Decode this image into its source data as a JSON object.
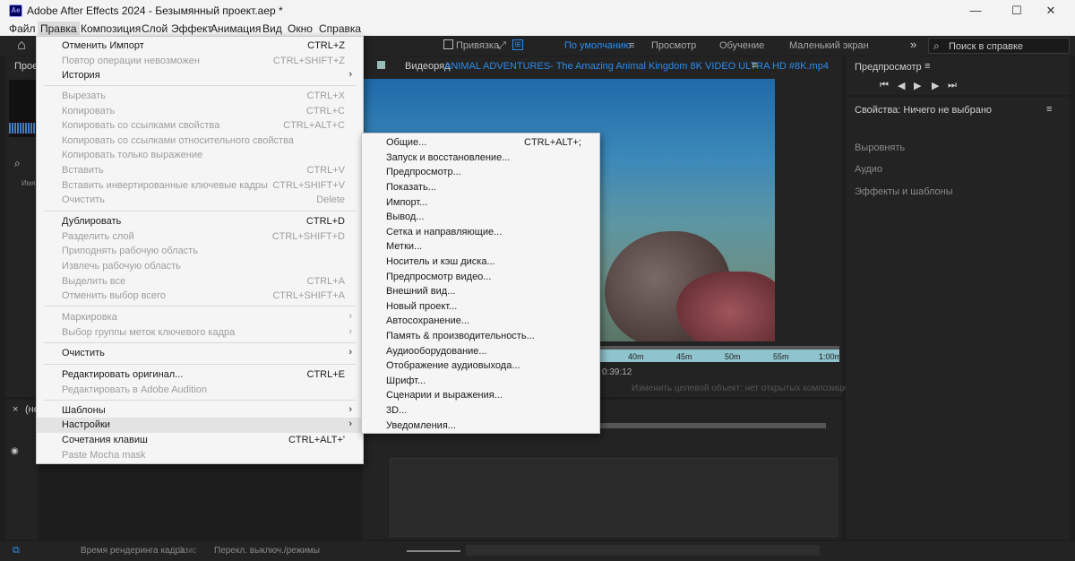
{
  "window": {
    "title": "Adobe After Effects 2024 - Безымянный проект.aep *",
    "logo": "Ae",
    "minimize": "—",
    "maximize": "☐",
    "close": "✕"
  },
  "menubar": [
    "Файл",
    "Правка",
    "Композиция",
    "Слой",
    "Эффект",
    "Анимация",
    "Вид",
    "Окно",
    "Справка"
  ],
  "toolbar": {
    "snap_label": "Привязка",
    "workspaces": [
      "По умолчанию",
      "Просмотр",
      "Обучение",
      "Маленький экран"
    ],
    "more": "»",
    "help_placeholder": "Поиск в справке"
  },
  "left_panel": {
    "tab": "Проек",
    "name_col": "Имя",
    "item": "(не"
  },
  "viewer": {
    "tab_prefix": "Видеоряд",
    "tab_file": "ANIMAL ADVENTURES- The Amazing Animal Kingdom 8K VIDEO ULTRA HD #8K.mp4",
    "ticks": [
      "40m",
      "45m",
      "50m",
      "55m",
      "1:00m"
    ],
    "timecode": "0:39:12",
    "target": "Изменить целевой объект: нет открытых композиций"
  },
  "right_panels": {
    "preview": "Предпросмотр",
    "properties": "Свойства: Ничего не выбрано",
    "align": "Выровнять",
    "audio": "Аудио",
    "effects": "Эффекты и шаблоны"
  },
  "edit_menu": [
    {
      "label": "Отменить Импорт",
      "shortcut": "CTRL+Z",
      "disabled": false
    },
    {
      "label": "Повтор операции невозможен",
      "shortcut": "CTRL+SHIFT+Z",
      "disabled": true
    },
    {
      "label": "История",
      "shortcut": "",
      "disabled": false,
      "submenu": true
    },
    {
      "label": "Вырезать",
      "shortcut": "CTRL+X",
      "disabled": true
    },
    {
      "label": "Копировать",
      "shortcut": "CTRL+C",
      "disabled": true
    },
    {
      "label": "Копировать со ссылками свойства",
      "shortcut": "CTRL+ALT+C",
      "disabled": true
    },
    {
      "label": "Копировать со ссылками относительного свойства",
      "shortcut": "",
      "disabled": true
    },
    {
      "label": "Копировать только выражение",
      "shortcut": "",
      "disabled": true
    },
    {
      "label": "Вставить",
      "shortcut": "CTRL+V",
      "disabled": true
    },
    {
      "label": "Вставить инвертированные ключевые кадры",
      "shortcut": "CTRL+SHIFT+V",
      "disabled": true
    },
    {
      "label": "Очистить",
      "shortcut": "Delete",
      "disabled": true
    },
    {
      "label": "Дублировать",
      "shortcut": "CTRL+D",
      "disabled": false
    },
    {
      "label": "Разделить слой",
      "shortcut": "CTRL+SHIFT+D",
      "disabled": true
    },
    {
      "label": "Приподнять рабочую область",
      "shortcut": "",
      "disabled": true
    },
    {
      "label": "Извлечь рабочую область",
      "shortcut": "",
      "disabled": true
    },
    {
      "label": "Выделить все",
      "shortcut": "CTRL+A",
      "disabled": true
    },
    {
      "label": "Отменить выбор всего",
      "shortcut": "CTRL+SHIFT+A",
      "disabled": true
    },
    {
      "label": "Маркировка",
      "shortcut": "",
      "disabled": true,
      "submenu": true
    },
    {
      "label": "Выбор группы меток ключевого кадра",
      "shortcut": "",
      "disabled": true,
      "submenu": true
    },
    {
      "label": "Очистить",
      "shortcut": "",
      "disabled": false,
      "submenu": true
    },
    {
      "label": "Редактировать оригинал...",
      "shortcut": "CTRL+E",
      "disabled": false
    },
    {
      "label": "Редактировать в Adobe Audition",
      "shortcut": "",
      "disabled": true
    },
    {
      "label": "Шаблоны",
      "shortcut": "",
      "disabled": false,
      "submenu": true
    },
    {
      "label": "Настройки",
      "shortcut": "",
      "disabled": false,
      "submenu": true,
      "highlighted": true
    },
    {
      "label": "Сочетания клавиш",
      "shortcut": "CTRL+ALT+'",
      "disabled": false
    },
    {
      "label": "Paste Mocha mask",
      "shortcut": "",
      "disabled": true
    }
  ],
  "prefs_submenu": [
    {
      "label": "Общие...",
      "shortcut": "CTRL+ALT+;"
    },
    {
      "label": "Запуск и восстановление...",
      "shortcut": ""
    },
    {
      "label": "Предпросмотр...",
      "shortcut": ""
    },
    {
      "label": "Показать...",
      "shortcut": ""
    },
    {
      "label": "Импорт...",
      "shortcut": ""
    },
    {
      "label": "Вывод...",
      "shortcut": ""
    },
    {
      "label": "Сетка и направляющие...",
      "shortcut": ""
    },
    {
      "label": "Метки...",
      "shortcut": ""
    },
    {
      "label": "Носитель и кэш диска...",
      "shortcut": ""
    },
    {
      "label": "Предпросмотр видео...",
      "shortcut": ""
    },
    {
      "label": "Внешний вид...",
      "shortcut": ""
    },
    {
      "label": "Новый проект...",
      "shortcut": ""
    },
    {
      "label": "Автосохранение...",
      "shortcut": ""
    },
    {
      "label": "Память & производительность...",
      "shortcut": ""
    },
    {
      "label": "Аудиооборудование...",
      "shortcut": ""
    },
    {
      "label": "Отображение аудиовыхода...",
      "shortcut": ""
    },
    {
      "label": "Шрифт...",
      "shortcut": ""
    },
    {
      "label": "Сценарии и выражения...",
      "shortcut": ""
    },
    {
      "label": "3D...",
      "shortcut": ""
    },
    {
      "label": "Уведомления...",
      "shortcut": ""
    }
  ],
  "statusbar": {
    "render_time": "Время рендеринга кадра:",
    "render_value": "0 мс",
    "toggle": "Перекл. выключ./режимы"
  },
  "colors": {
    "accent": "#2d8ceb",
    "menu_bg": "#f5f5f5",
    "app_bg": "#1d1d1d"
  }
}
